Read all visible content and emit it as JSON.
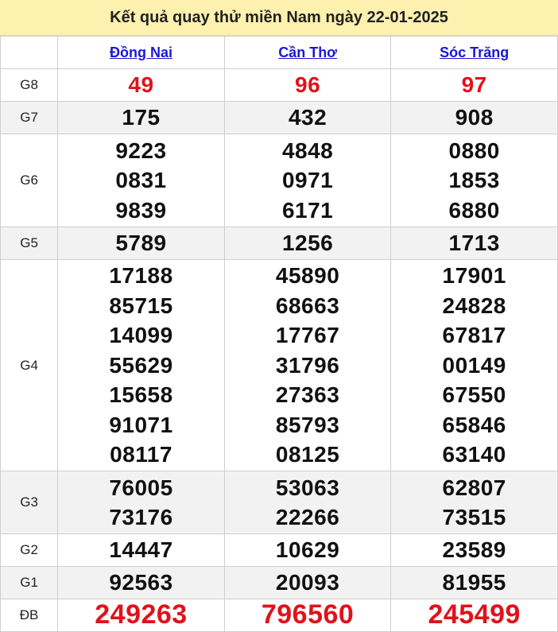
{
  "title": "Kết quả quay thử miền Nam ngày 22-01-2025",
  "provinces": [
    "Đồng Nai",
    "Cần Thơ",
    "Sóc Trăng"
  ],
  "colors": {
    "header_bg": "#fef1b0",
    "link": "#1a18d8",
    "highlight": "#e0121a",
    "alt_row": "#f2f2f2"
  },
  "rows": [
    {
      "label": "G8",
      "values": [
        [
          "49"
        ],
        [
          "96"
        ],
        [
          "97"
        ]
      ]
    },
    {
      "label": "G7",
      "values": [
        [
          "175"
        ],
        [
          "432"
        ],
        [
          "908"
        ]
      ]
    },
    {
      "label": "G6",
      "values": [
        [
          "9223",
          "0831",
          "9839"
        ],
        [
          "4848",
          "0971",
          "6171"
        ],
        [
          "0880",
          "1853",
          "6880"
        ]
      ]
    },
    {
      "label": "G5",
      "values": [
        [
          "5789"
        ],
        [
          "1256"
        ],
        [
          "1713"
        ]
      ]
    },
    {
      "label": "G4",
      "values": [
        [
          "17188",
          "85715",
          "14099",
          "55629",
          "15658",
          "91071",
          "08117"
        ],
        [
          "45890",
          "68663",
          "17767",
          "31796",
          "27363",
          "85793",
          "08125"
        ],
        [
          "17901",
          "24828",
          "67817",
          "00149",
          "67550",
          "65846",
          "63140"
        ]
      ]
    },
    {
      "label": "G3",
      "values": [
        [
          "76005",
          "73176"
        ],
        [
          "53063",
          "22266"
        ],
        [
          "62807",
          "73515"
        ]
      ]
    },
    {
      "label": "G2",
      "values": [
        [
          "14447"
        ],
        [
          "10629"
        ],
        [
          "23589"
        ]
      ]
    },
    {
      "label": "G1",
      "values": [
        [
          "92563"
        ],
        [
          "20093"
        ],
        [
          "81955"
        ]
      ]
    },
    {
      "label": "ĐB",
      "values": [
        [
          "249263"
        ],
        [
          "796560"
        ],
        [
          "245499"
        ]
      ]
    }
  ]
}
